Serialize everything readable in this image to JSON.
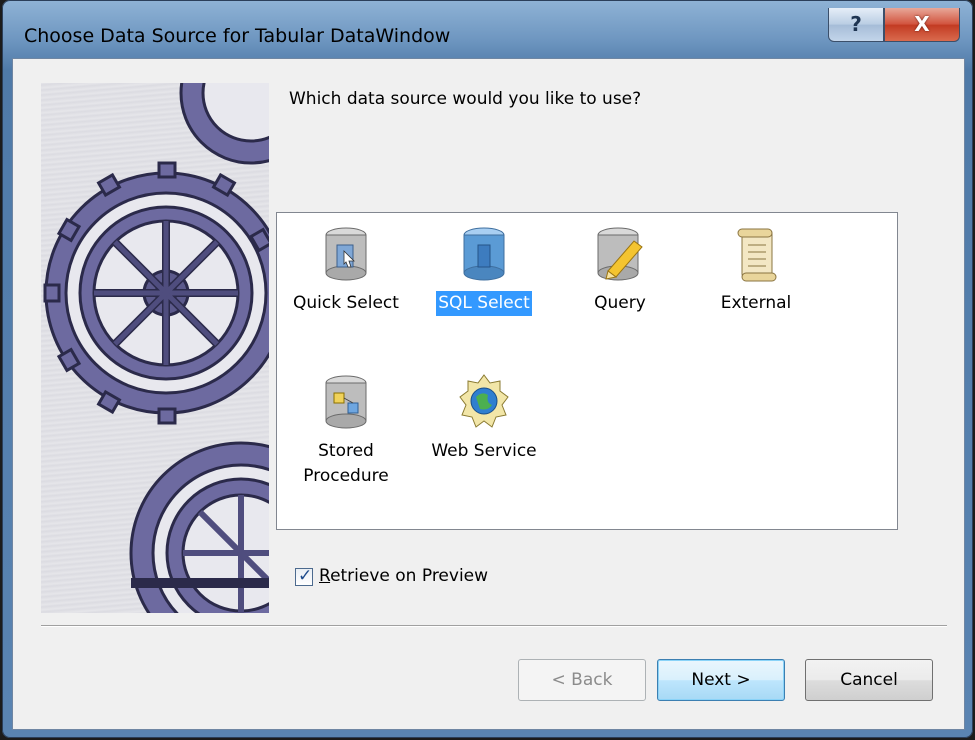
{
  "window": {
    "title": "Choose Data Source for Tabular DataWindow",
    "help_glyph": "?",
    "close_glyph": "X"
  },
  "question": "Which data source would you like to use?",
  "sources": [
    {
      "label": "Quick Select",
      "icon": "database-document-icon",
      "selected": false
    },
    {
      "label": "SQL Select",
      "icon": "database-blue-icon",
      "selected": true
    },
    {
      "label": "Query",
      "icon": "database-pencil-icon",
      "selected": false
    },
    {
      "label": "External",
      "icon": "scroll-document-icon",
      "selected": false
    },
    {
      "label": "Stored\nProcedure",
      "icon": "database-procedure-icon",
      "selected": false
    },
    {
      "label": "Web Service",
      "icon": "globe-gear-icon",
      "selected": false
    }
  ],
  "retrieve": {
    "label_prefix": "R",
    "label_rest": "etrieve on Preview",
    "checked": true,
    "check_glyph": "✓"
  },
  "buttons": {
    "back": "< Back",
    "next": "Next >",
    "cancel": "Cancel"
  },
  "colors": {
    "selection": "#3399ff",
    "gear": "#5c5a8c"
  }
}
